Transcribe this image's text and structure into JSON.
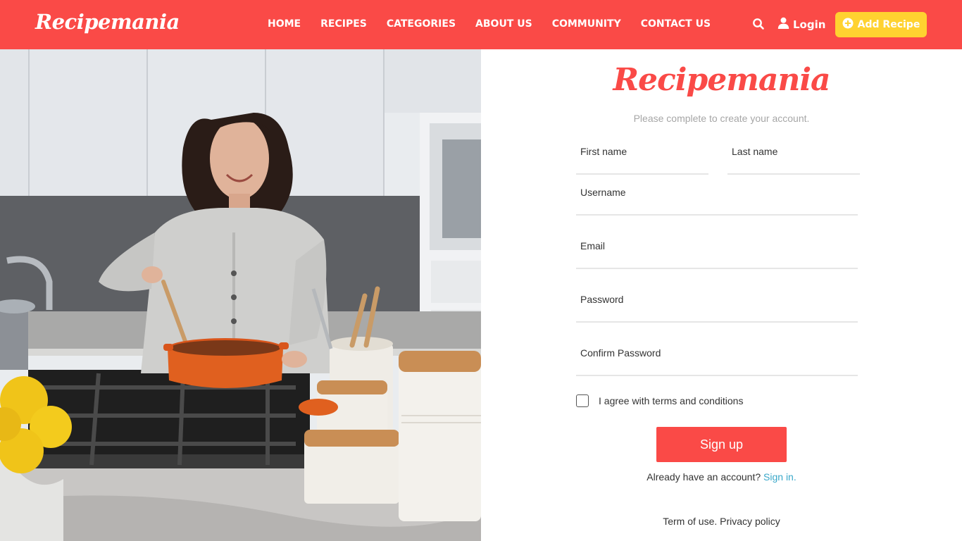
{
  "nav": {
    "brand": "Recipemania",
    "links": [
      "HOME",
      "RECIPES",
      "CATEGORIES",
      "ABOUT US",
      "COMMUNITY",
      "CONTACT US"
    ],
    "search_icon": "search-icon",
    "login_label": "Login",
    "login_icon": "user-icon",
    "add_recipe_label": "Add Recipe",
    "add_recipe_icon": "plus-circle-icon"
  },
  "hero": {
    "image": "woman-cooking-photo"
  },
  "form": {
    "logo": "Recipemania",
    "subtitle": "Please complete to create your account.",
    "first_name_placeholder": "First name",
    "last_name_placeholder": "Last name",
    "username_placeholder": "Username",
    "email_placeholder": "Email",
    "password_placeholder": "Password",
    "confirm_password_placeholder": "Confirm Password",
    "agree_label": "I agree with terms and conditions",
    "agree_checked": false,
    "signup_label": "Sign up",
    "have_account_text": "Already have an account?",
    "signin_label": "Sign in.",
    "terms_label": "Term of use.",
    "privacy_label": "Privacy policy"
  },
  "colors": {
    "brand_red": "#fa4a47",
    "add_button_yellow": "#ffd230",
    "link_blue": "#3aa8c9"
  }
}
